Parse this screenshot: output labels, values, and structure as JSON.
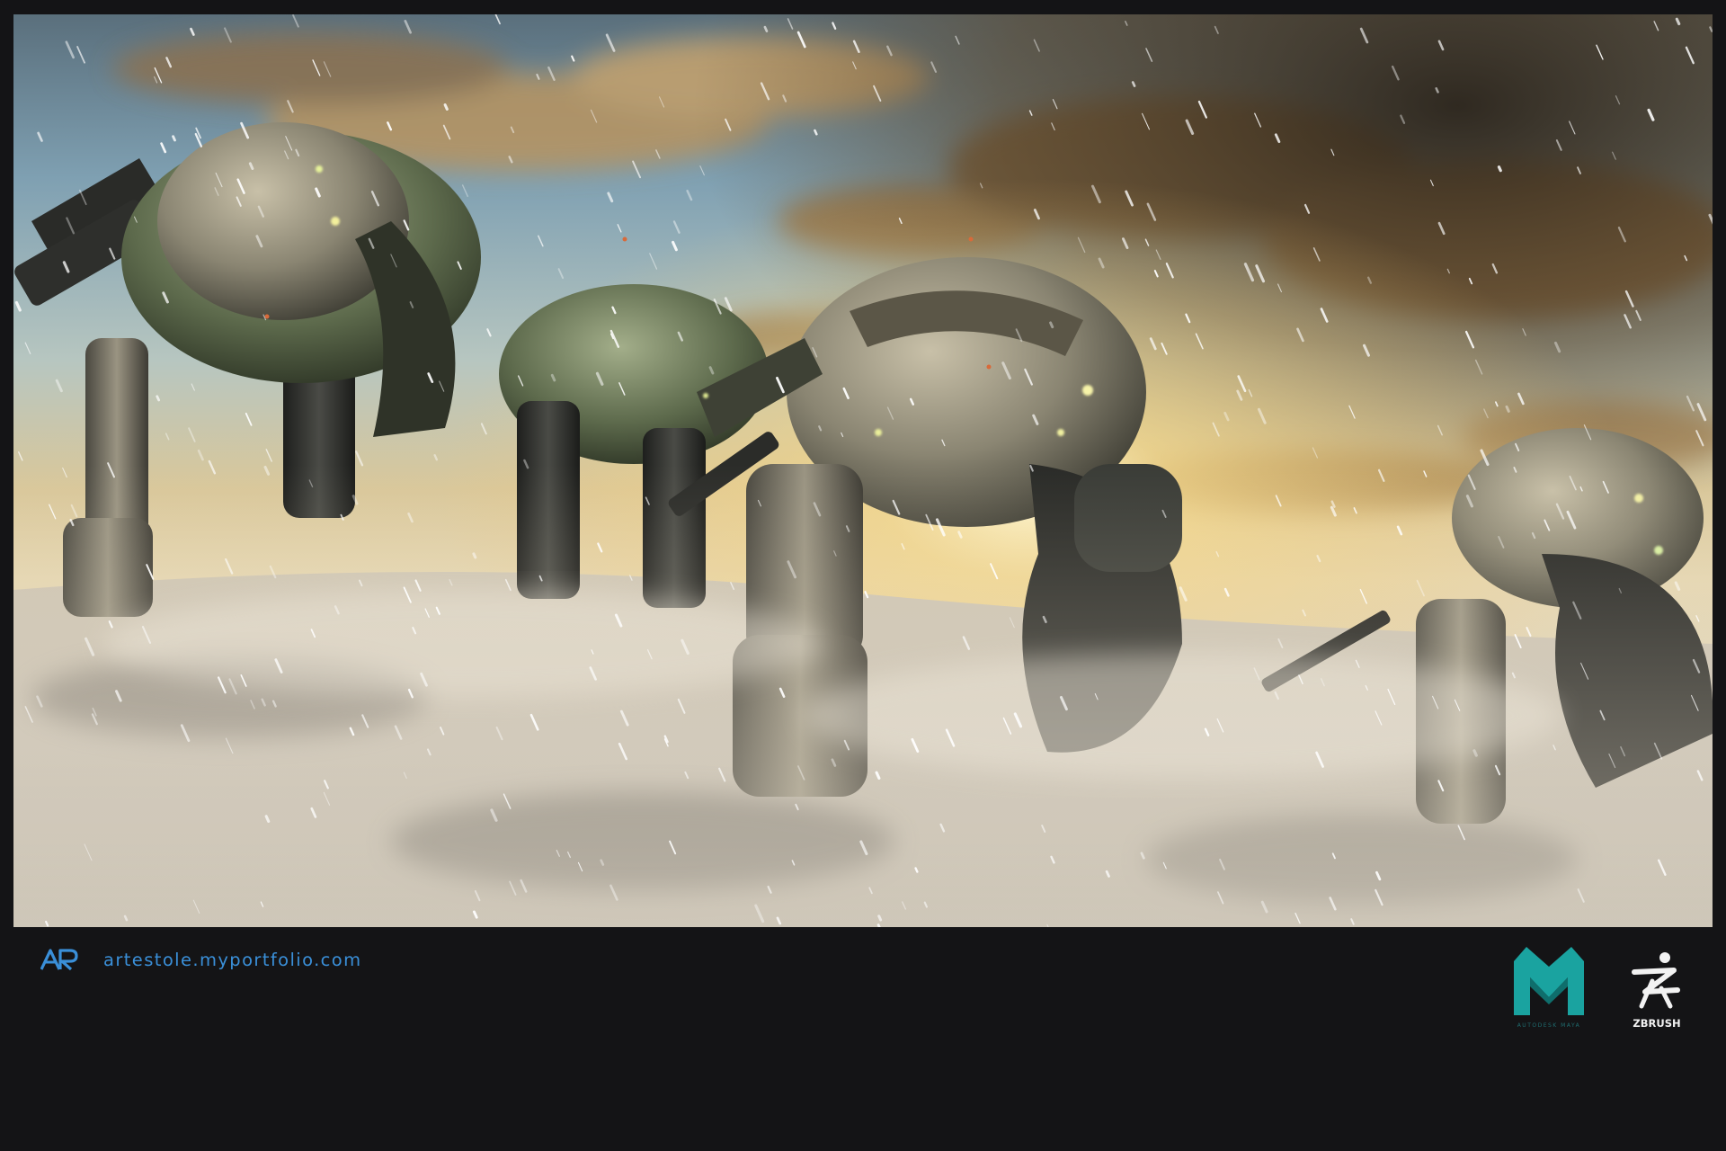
{
  "artwork": {
    "scene": "snow-storm-mech-squad"
  },
  "footer": {
    "brand_initials": "AR",
    "portfolio_url": "artestole.myportfolio.com",
    "maya_caption": "AUTODESK MAYA",
    "zbrush_label": "ZBRUSH",
    "colors": {
      "url_blue": "#3a8fd8",
      "maya_teal": "#1aa3a0",
      "background": "#141416"
    }
  },
  "icons": {
    "brand": "ar-monogram-icon",
    "maya": "maya-logo-icon",
    "zbrush": "zbrush-logo-icon"
  }
}
